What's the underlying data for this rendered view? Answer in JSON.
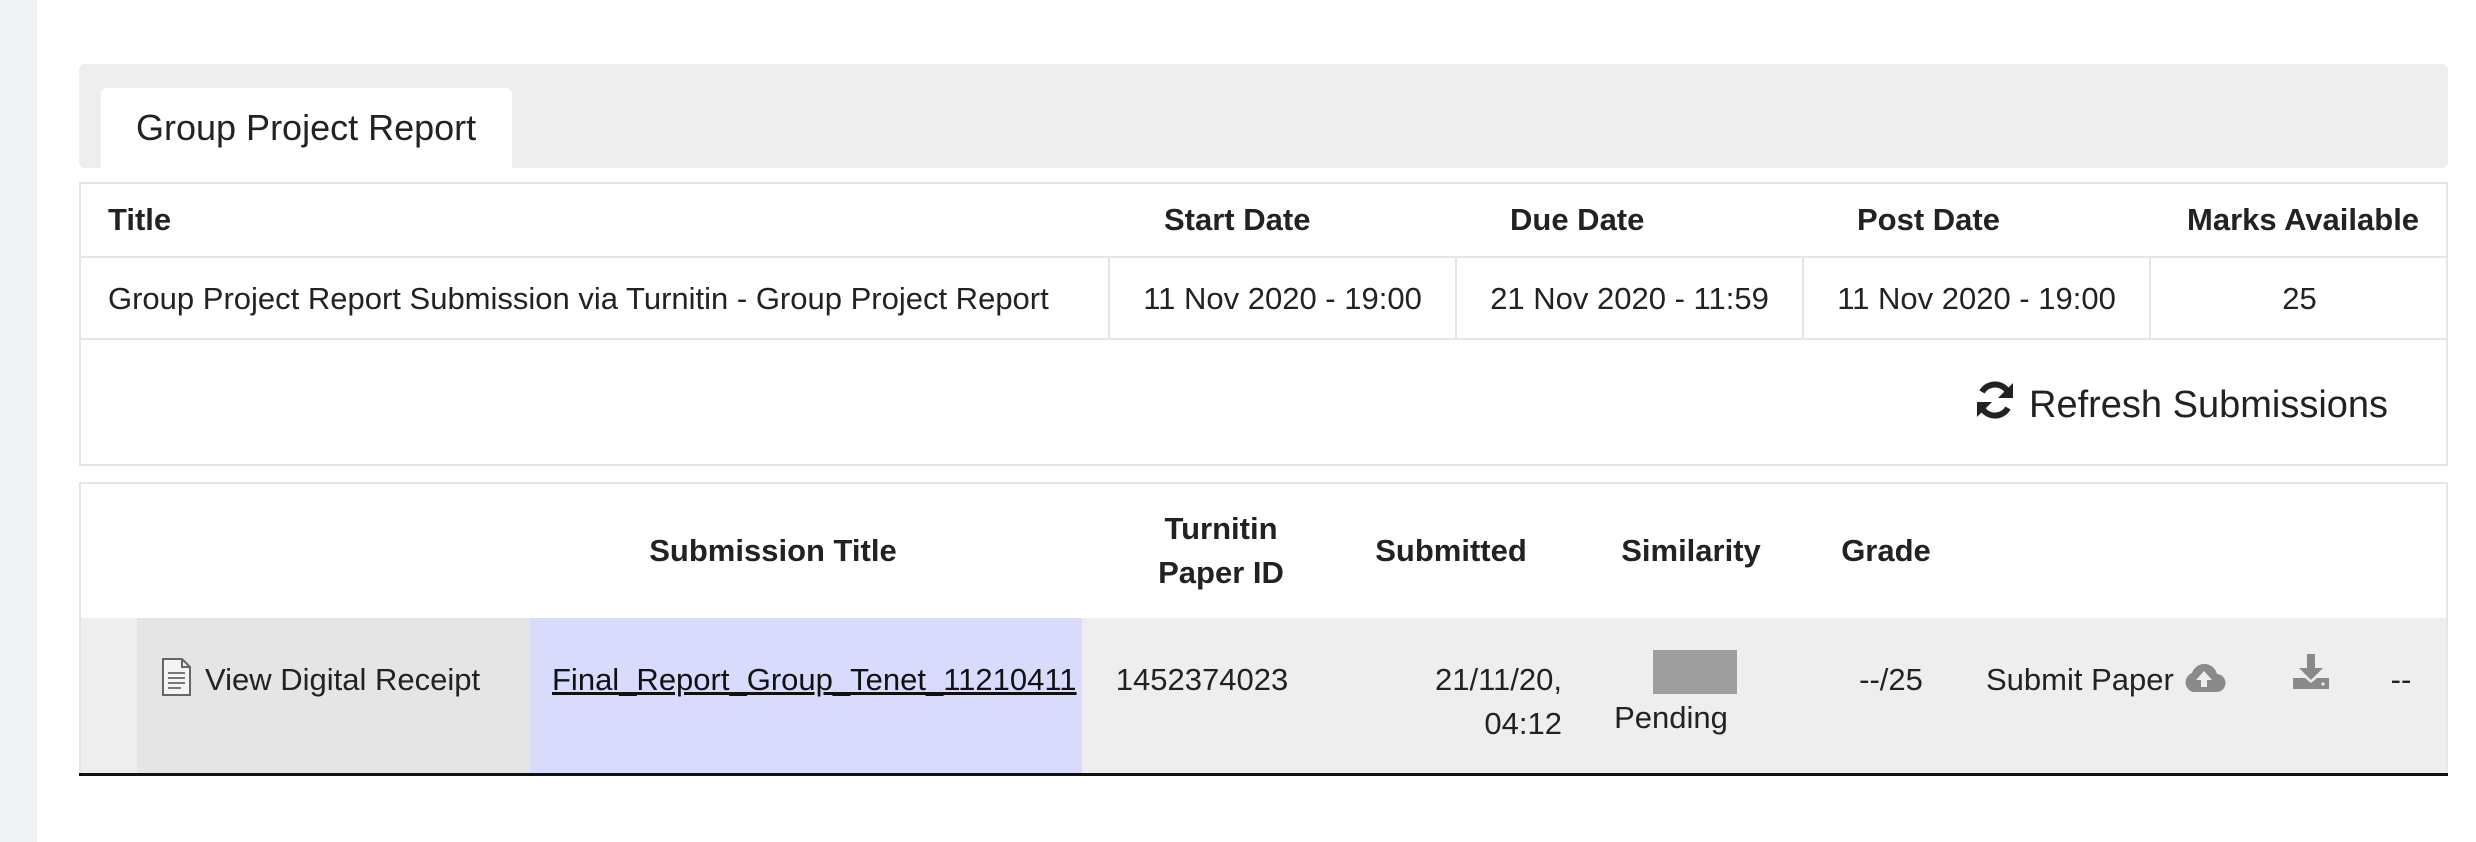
{
  "tab": {
    "label": "Group Project Report"
  },
  "assignment": {
    "headers": {
      "title": "Title",
      "start": "Start Date",
      "due": "Due Date",
      "post": "Post Date",
      "marks": "Marks Available"
    },
    "row": {
      "title": "Group Project Report Submission via Turnitin - Group Project Report",
      "start": "11 Nov 2020 - 19:00",
      "due": "21 Nov 2020 - 11:59",
      "post": "11 Nov 2020 - 19:00",
      "marks": "25"
    }
  },
  "refresh": {
    "label": "Refresh Submissions",
    "icon": "refresh-icon"
  },
  "submissions": {
    "headers": {
      "submission_title": "Submission Title",
      "paper_id_line1": "Turnitin",
      "paper_id_line2": "Paper ID",
      "submitted": "Submitted",
      "similarity": "Similarity",
      "grade": "Grade"
    },
    "row": {
      "receipt": "View Digital Receipt",
      "receipt_icon": "document-icon",
      "title": "Final_Report_Group_Tenet_11210411",
      "paper_id": "1452374023",
      "submitted_line1": "21/11/20,",
      "submitted_line2": "04:12",
      "similarity": "Pending",
      "grade": "--/25",
      "submit": "Submit Paper",
      "submit_icon": "cloud-upload-icon",
      "download_icon": "download-icon",
      "last": "--"
    }
  }
}
